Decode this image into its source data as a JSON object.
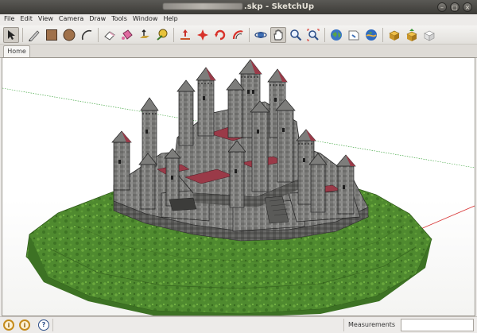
{
  "window": {
    "title_suffix": ".skp - SketchUp",
    "minimize_glyph": "–",
    "maximize_glyph": "▢",
    "close_glyph": "×"
  },
  "menu": [
    "File",
    "Edit",
    "View",
    "Camera",
    "Draw",
    "Tools",
    "Window",
    "Help"
  ],
  "toolbar": {
    "tools": [
      "select-arrow-icon",
      "pencil-line-icon",
      "rectangle-icon",
      "circle-icon",
      "arc-icon",
      "eraser-icon",
      "paint-bucket-icon",
      "push-pull-icon",
      "tape-measure-icon",
      "move-icon",
      "rotate-icon",
      "follow-me-icon",
      "offset-icon",
      "orbit-icon",
      "pan-icon",
      "zoom-icon",
      "zoom-extents-icon",
      "get-models-icon",
      "share-model-icon",
      "google-earth-icon",
      "warehouse-get-icon",
      "warehouse-share-icon",
      "components-icon"
    ]
  },
  "tabs": [
    {
      "label": "Home"
    }
  ],
  "status": {
    "measurements_label": "Measurements",
    "measurements_value": "",
    "icon_1": "i",
    "icon_2": "i",
    "icon_help": "?"
  },
  "colors": {
    "accent_blue": "#3f6fb5",
    "grass": "#4f8a2f",
    "stone": "#7d7d7b",
    "roof_red": "#9a3a48",
    "axis_red": "#d93a3a",
    "axis_green": "#2e9e2e"
  }
}
